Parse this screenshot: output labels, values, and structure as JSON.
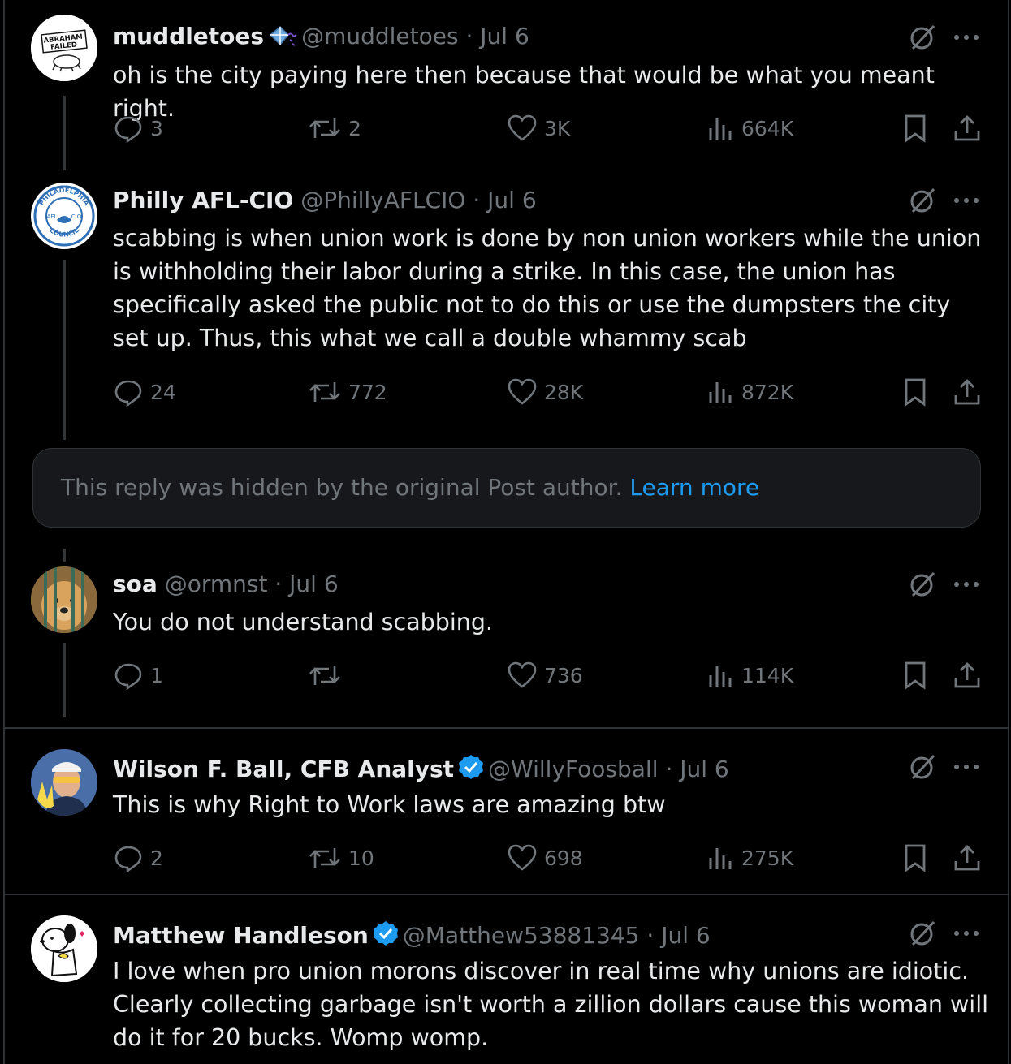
{
  "posts": [
    {
      "name": "muddletoes",
      "handle": "@muddletoes",
      "sep": "·",
      "date": "Jul 6",
      "text": "oh is the city paying here then because that would be what you meant right.",
      "replies": "3",
      "reposts": "2",
      "likes": "3K",
      "views": "664K",
      "avatar_text": [
        "ABRAHAM",
        "FAILED"
      ]
    },
    {
      "name": "Philly AFL-CIO",
      "handle": "@PhillyAFLCIO",
      "sep": "·",
      "date": "Jul 6",
      "text": "scabbing is when union work is done by non union workers while the union is withholding their labor during a strike. In this case, the union has specifically asked the public not to do this or use the dumpsters the city set up. Thus, this what we call a double whammy scab",
      "replies": "24",
      "reposts": "772",
      "likes": "28K",
      "views": "872K",
      "avatar_text": [
        "PHILADELPHIA",
        "AFL",
        "CIO",
        "COUNCIL"
      ]
    },
    {
      "name": "soa",
      "handle": "@ormnst",
      "sep": "·",
      "date": "Jul 6",
      "text": "You do not understand scabbing.",
      "replies": "1",
      "reposts": "",
      "likes": "736",
      "views": "114K"
    },
    {
      "name": "Wilson F. Ball, CFB Analyst",
      "handle": "@WillyFoosball",
      "sep": "·",
      "date": "Jul 6",
      "text": "This is why Right to Work laws are amazing btw",
      "replies": "2",
      "reposts": "10",
      "likes": "698",
      "views": "275K",
      "verified": true
    },
    {
      "name": "Matthew Handleson",
      "handle": "@Matthew53881345",
      "sep": "·",
      "date": "Jul 6",
      "text": "I love when pro union morons discover in real time why unions are idiotic. Clearly collecting garbage isn't worth a zillion dollars cause this woman will do it for 20 bucks. Womp womp.",
      "verified": true
    }
  ],
  "hidden_reply": {
    "text": "This reply was hidden by the original Post author.",
    "link": "Learn more"
  },
  "colors": {
    "background": "#000000",
    "text": "#e7e9ea",
    "muted": "#71767b",
    "link": "#1d9bf0",
    "verified": "#1d9bf0"
  },
  "icons": [
    "grok-icon",
    "more-icon",
    "reply-icon",
    "repost-icon",
    "like-icon",
    "views-icon",
    "bookmark-icon",
    "share-icon",
    "verified-badge-icon",
    "kite-emoji-icon"
  ]
}
